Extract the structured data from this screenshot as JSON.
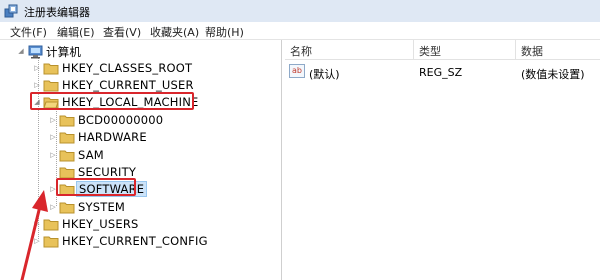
{
  "window": {
    "title": "注册表编辑器"
  },
  "menu": [
    {
      "label": "文件(F)"
    },
    {
      "label": "编辑(E)"
    },
    {
      "label": "查看(V)"
    },
    {
      "label": "收藏夹(A)"
    },
    {
      "label": "帮助(H)"
    }
  ],
  "tree": {
    "root": "计算机",
    "hives": {
      "classes_root": "HKEY_CLASSES_ROOT",
      "current_user": "HKEY_CURRENT_USER",
      "local_machine": "HKEY_LOCAL_MACHINE",
      "users": "HKEY_USERS",
      "current_config": "HKEY_CURRENT_CONFIG"
    },
    "local_machine_children": {
      "bcd": "BCD00000000",
      "hardware": "HARDWARE",
      "sam": "SAM",
      "security": "SECURITY",
      "software": "SOFTWARE",
      "system": "SYSTEM"
    }
  },
  "list": {
    "columns": {
      "name": "名称",
      "type": "类型",
      "data": "数据"
    },
    "rows": [
      {
        "name": "(默认)",
        "type": "REG_SZ",
        "data": "(数值未设置)"
      }
    ]
  },
  "colors": {
    "highlight": "#d9262c",
    "folder": "#e8c25a",
    "selection": "#cce3f9"
  }
}
